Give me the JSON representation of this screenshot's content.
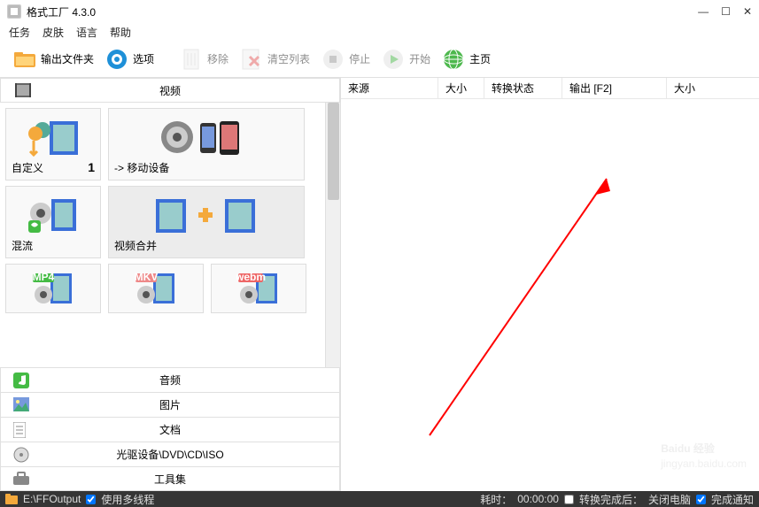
{
  "window": {
    "title": "格式工厂 4.3.0"
  },
  "menu": {
    "task": "任务",
    "skin": "皮肤",
    "language": "语言",
    "help": "帮助"
  },
  "toolbar": {
    "output_folder": "输出文件夹",
    "options": "选项",
    "remove": "移除",
    "clear_list": "清空列表",
    "stop": "停止",
    "start": "开始",
    "home": "主页"
  },
  "categories": {
    "video": "视频",
    "audio": "音频",
    "picture": "图片",
    "document": "文档",
    "disc": "光驱设备\\DVD\\CD\\ISO",
    "toolbox": "工具集"
  },
  "tiles": {
    "custom": "自定义",
    "custom_count": "1",
    "mobile": "-> 移动设备",
    "mixflow": "混流",
    "video_merge": "视频合并",
    "mp4": "MP4",
    "mkv": "MKV",
    "webm": "webm"
  },
  "table": {
    "source": "来源",
    "size": "大小",
    "convert_state": "转换状态",
    "output": "输出 [F2]",
    "size2": "大小"
  },
  "statusbar": {
    "output_path": "E:\\FFOutput",
    "multithread": "使用多线程",
    "elapsed_label": "耗时：",
    "elapsed_time": "00:00:00",
    "after_convert": "转换完成后：",
    "shutdown": "关闭电脑",
    "notify": "完成通知"
  },
  "watermark": {
    "brand": "Baidu 经验",
    "url": "jingyan.baidu.com"
  }
}
